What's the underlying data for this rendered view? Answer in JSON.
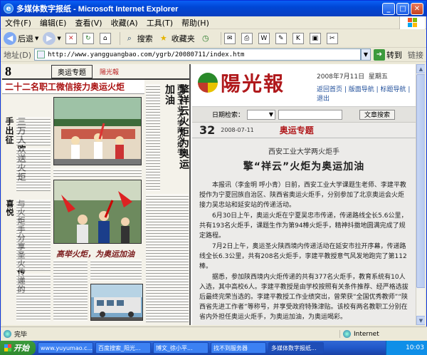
{
  "window": {
    "title": "多媒体数字报纸 - Microsoft Internet Explorer",
    "ie_glyph": "e",
    "min": "_",
    "max": "□",
    "close": "✕"
  },
  "menu": [
    "文件(F)",
    "编辑(E)",
    "查看(V)",
    "收藏(A)",
    "工具(T)",
    "帮助(H)"
  ],
  "toolbar": {
    "back": "后退",
    "search": "搜索",
    "favorites": "收藏夹"
  },
  "address": {
    "label": "地址(D)",
    "url": "http://www.yangguangbao.com/ygrb/20080711/index.htm",
    "go": "转到",
    "links": "链接"
  },
  "newspaper_left": {
    "page_num": "8",
    "section": "奥运专题",
    "brand": "陽光報",
    "headline": "二十二名职工微信接力奥运火炬",
    "col1_vertical_1": "三万人欢送火炬手出征",
    "col1_vertical_2": "与火炬手分享圣火传递的喜悦",
    "col2_vertical_1": "西安工业大学两火炬手",
    "col2_vertical_2": "擎祥云火炬为奥运加油",
    "calligraphy": "高举火炬，为奥运加油"
  },
  "site": {
    "logo": "陽光報",
    "date": "2008年7月11日",
    "weekday": "星期五",
    "nav": "返回首页 | 版面导航 | 标题导航 | 退出",
    "search_label": "日期检索：",
    "search_button": "文章搜索"
  },
  "page_strip": {
    "number": "32",
    "date": "2008-07-11",
    "section": "奥运专题"
  },
  "article": {
    "subtitle": "西安工业大学两火炬手",
    "title": "擎“祥云”火炬为奥运加油",
    "paragraphs": [
      "本报讯（李金明 呼小青）日前，西安工业大学课题生老师、李建平教授作为宁夏回族自治区、陕西省奥运火炬手，分别参加了北京奥运会火炬接力吴忠站和延安站的传递活动。",
      "6月30日上午，奥运火炬在宁夏吴忠市传递，传递路线全长5.6公里，共有193名火炬手，课题生作为第94棒火炬手，精神抖擞地圆满完成了规定路程。",
      "7月2日上午，奥运圣火陕西境内传递活动在延安市拉开序幕，传递路线全长6.3公里，共有208名火炬手，李建平教授意气风发地跑完了第112棒。",
      "据悉，参加陕西境内火炬传递的共有377名火炬手，教育系统有10人入选，其中高校6人。李建平教授是由学校按照有关条件推荐、经严格选拔后最终完荣当选的。李建平教授工作业绩突出，曾荣获“全国优秀教师”“陕西省先进工作者”等称号，并享受政府特殊津贴。该校有两名教职工分别在省内外担任奥运火炬手，为奥运加油，为奥运喝彩。"
    ]
  },
  "status": {
    "done": "完毕",
    "zone": "Internet"
  },
  "taskbar": {
    "start": "开始",
    "tasks": [
      "www.yuyumao.c...",
      "百度搜索_阳光...",
      "博文_徐小平...",
      "找不到服务器",
      "多媒体数字报纸..."
    ],
    "clock": "10:03"
  }
}
